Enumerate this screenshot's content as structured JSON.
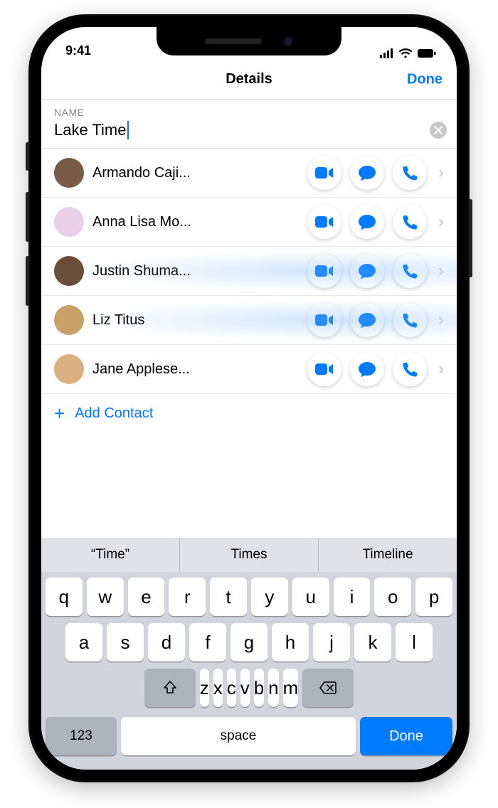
{
  "status": {
    "time": "9:41"
  },
  "nav": {
    "title": "Details",
    "done": "Done"
  },
  "name_section": {
    "header": "NAME",
    "value": "Lake Time"
  },
  "contacts": [
    {
      "name": "Armando Caji...",
      "avatar_bg": "#7a5b47"
    },
    {
      "name": "Anna Lisa Mo...",
      "avatar_bg": "#e9cfe8"
    },
    {
      "name": "Justin Shuma...",
      "avatar_bg": "#6b4d3b",
      "glow": true
    },
    {
      "name": "Liz Titus",
      "avatar_bg": "#c9a06a",
      "glow": true
    },
    {
      "name": "Jane Applese...",
      "avatar_bg": "#d9b080"
    }
  ],
  "add_contact": "Add Contact",
  "suggestions": [
    "“Time”",
    "Times",
    "Timeline"
  ],
  "keyboard": {
    "row1": [
      "q",
      "w",
      "e",
      "r",
      "t",
      "y",
      "u",
      "i",
      "o",
      "p"
    ],
    "row2": [
      "a",
      "s",
      "d",
      "f",
      "g",
      "h",
      "j",
      "k",
      "l"
    ],
    "row3": [
      "z",
      "x",
      "c",
      "v",
      "b",
      "n",
      "m"
    ],
    "numbers": "123",
    "space": "space",
    "done": "Done"
  }
}
